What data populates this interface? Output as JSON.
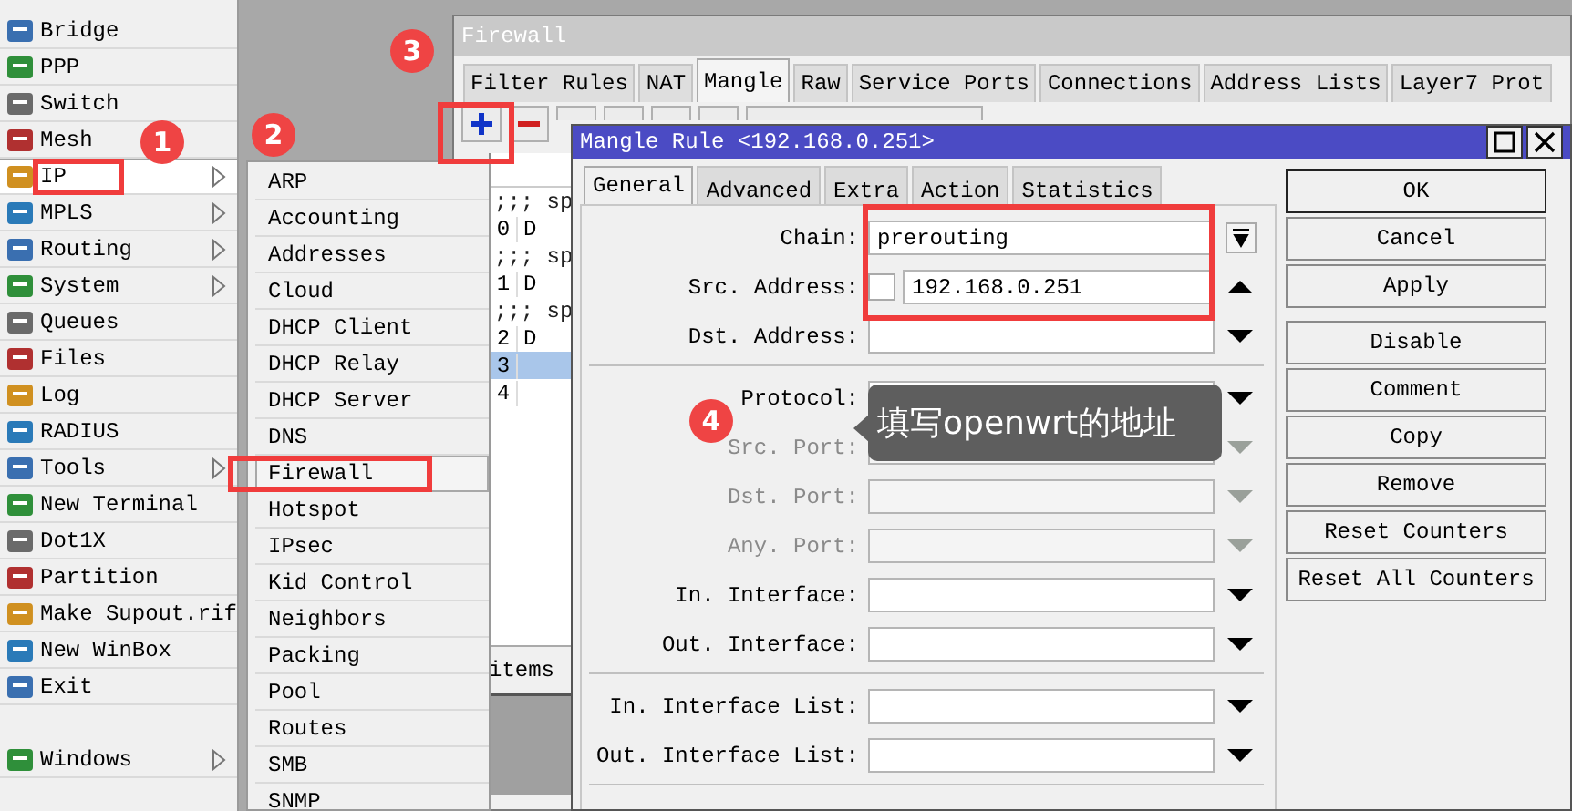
{
  "main_menu": {
    "groups": [
      {
        "items": [
          {
            "label": "Bridge",
            "selected": false,
            "has_submenu": false
          },
          {
            "label": "PPP",
            "selected": false,
            "has_submenu": false
          },
          {
            "label": "Switch",
            "selected": false,
            "has_submenu": false
          },
          {
            "label": "Mesh",
            "selected": false,
            "has_submenu": false
          },
          {
            "label": "IP",
            "selected": true,
            "has_submenu": true
          },
          {
            "label": "MPLS",
            "selected": false,
            "has_submenu": true
          },
          {
            "label": "Routing",
            "selected": false,
            "has_submenu": true
          },
          {
            "label": "System",
            "selected": false,
            "has_submenu": true
          },
          {
            "label": "Queues",
            "selected": false,
            "has_submenu": false
          },
          {
            "label": "Files",
            "selected": false,
            "has_submenu": false
          },
          {
            "label": "Log",
            "selected": false,
            "has_submenu": false
          },
          {
            "label": "RADIUS",
            "selected": false,
            "has_submenu": false
          },
          {
            "label": "Tools",
            "selected": false,
            "has_submenu": true
          },
          {
            "label": "New Terminal",
            "selected": false,
            "has_submenu": false
          },
          {
            "label": "Dot1X",
            "selected": false,
            "has_submenu": false
          },
          {
            "label": "Partition",
            "selected": false,
            "has_submenu": false
          },
          {
            "label": "Make Supout.rif",
            "selected": false,
            "has_submenu": false
          },
          {
            "label": "New WinBox",
            "selected": false,
            "has_submenu": false
          },
          {
            "label": "Exit",
            "selected": false,
            "has_submenu": false
          }
        ]
      },
      {
        "items": [
          {
            "label": "Windows",
            "selected": false,
            "has_submenu": true
          }
        ]
      }
    ]
  },
  "ip_submenu": {
    "items": [
      {
        "label": "ARP",
        "selected": false
      },
      {
        "label": "Accounting",
        "selected": false
      },
      {
        "label": "Addresses",
        "selected": false
      },
      {
        "label": "Cloud",
        "selected": false
      },
      {
        "label": "DHCP Client",
        "selected": false
      },
      {
        "label": "DHCP Relay",
        "selected": false
      },
      {
        "label": "DHCP Server",
        "selected": false
      },
      {
        "label": "DNS",
        "selected": false
      },
      {
        "label": "Firewall",
        "selected": true
      },
      {
        "label": "Hotspot",
        "selected": false
      },
      {
        "label": "IPsec",
        "selected": false
      },
      {
        "label": "Kid Control",
        "selected": false
      },
      {
        "label": "Neighbors",
        "selected": false
      },
      {
        "label": "Packing",
        "selected": false
      },
      {
        "label": "Pool",
        "selected": false
      },
      {
        "label": "Routes",
        "selected": false
      },
      {
        "label": "SMB",
        "selected": false
      },
      {
        "label": "SNMP",
        "selected": false
      }
    ]
  },
  "firewall_window": {
    "title": "Firewall",
    "tabs": [
      {
        "label": "Filter Rules",
        "selected": false
      },
      {
        "label": "NAT",
        "selected": false
      },
      {
        "label": "Mangle",
        "selected": true
      },
      {
        "label": "Raw",
        "selected": false
      },
      {
        "label": "Service Ports",
        "selected": false
      },
      {
        "label": "Connections",
        "selected": false
      },
      {
        "label": "Address Lists",
        "selected": false
      },
      {
        "label": "Layer7 Prot",
        "selected": false
      }
    ],
    "rows": [
      {
        "kind": "comment",
        "text": ";;; sp",
        "selected": false
      },
      {
        "kind": "rule",
        "number": "0",
        "flag": "D",
        "selected": false
      },
      {
        "kind": "comment",
        "text": ";;; sp",
        "selected": false
      },
      {
        "kind": "rule",
        "number": "1",
        "flag": "D",
        "selected": false
      },
      {
        "kind": "comment",
        "text": ";;; sp",
        "selected": false
      },
      {
        "kind": "rule",
        "number": "2",
        "flag": "D",
        "selected": false
      },
      {
        "kind": "rule",
        "number": "3",
        "selected": true
      },
      {
        "kind": "rule",
        "number": "4",
        "selected": false
      }
    ],
    "status": "items"
  },
  "mangle_dialog": {
    "title": "Mangle Rule <192.168.0.251>",
    "tabs": [
      {
        "label": "General",
        "selected": true
      },
      {
        "label": "Advanced",
        "selected": false
      },
      {
        "label": "Extra",
        "selected": false
      },
      {
        "label": "Action",
        "selected": false
      },
      {
        "label": "Statistics",
        "selected": false
      }
    ],
    "field_groups": [
      {
        "fields": [
          {
            "label": "Chain:",
            "kind": "dropdown",
            "value": "prerouting"
          },
          {
            "label": "Src. Address:",
            "kind": "address",
            "checked": false,
            "value": "192.168.0.251",
            "expanded": true,
            "disabled": false
          },
          {
            "label": "Dst. Address:",
            "kind": "plain",
            "expanded": false,
            "disabled": false
          }
        ]
      },
      {
        "fields": [
          {
            "label": "Protocol:",
            "kind": "plain",
            "expanded": false,
            "disabled": false
          },
          {
            "label": "Src. Port:",
            "kind": "plain",
            "expanded": false,
            "disabled": true
          },
          {
            "label": "Dst. Port:",
            "kind": "plain",
            "expanded": false,
            "disabled": true
          },
          {
            "label": "Any. Port:",
            "kind": "plain",
            "expanded": false,
            "disabled": true
          },
          {
            "label": "In. Interface:",
            "kind": "plain",
            "expanded": false,
            "disabled": false
          },
          {
            "label": "Out. Interface:",
            "kind": "plain",
            "expanded": false,
            "disabled": false
          }
        ]
      },
      {
        "fields": [
          {
            "label": "In. Interface List:",
            "kind": "plain",
            "expanded": false,
            "disabled": false
          },
          {
            "label": "Out. Interface List:",
            "kind": "plain",
            "expanded": false,
            "disabled": false
          }
        ]
      }
    ],
    "button_groups": [
      {
        "buttons": [
          {
            "label": "OK",
            "default": true
          },
          {
            "label": "Cancel",
            "default": false
          },
          {
            "label": "Apply",
            "default": false
          }
        ]
      },
      {
        "buttons": [
          {
            "label": "Disable",
            "default": false
          },
          {
            "label": "Comment",
            "default": false
          },
          {
            "label": "Copy",
            "default": false
          },
          {
            "label": "Remove",
            "default": false
          },
          {
            "label": "Reset Counters",
            "default": false
          },
          {
            "label": "Reset All Counters",
            "default": false
          }
        ]
      }
    ]
  },
  "annotations": {
    "markers": [
      {
        "label": "1"
      },
      {
        "label": "2"
      },
      {
        "label": "3"
      },
      {
        "label": "4"
      }
    ],
    "tooltip": "填写openwrt的地址"
  }
}
